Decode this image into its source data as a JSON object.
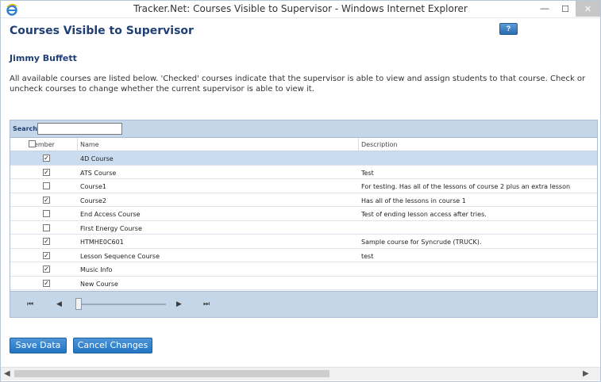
{
  "window": {
    "title": "Tracker.Net: Courses Visible to Supervisor - Windows Internet Explorer",
    "controls": {
      "minimize": "—",
      "maximize": "☐",
      "close": "✕"
    }
  },
  "page": {
    "title": "Courses Visible to Supervisor",
    "help_label": "?",
    "supervisor_name": "Jimmy Buffett",
    "intro": "All available courses are listed below. 'Checked' courses indicate that the supervisor is able to view and assign students to that course. Check or uncheck courses to change whether the current supervisor is able to view it."
  },
  "grid": {
    "search_label": "Search:",
    "search_value": "",
    "columns": {
      "member": "Member",
      "name": "Name",
      "description": "Description"
    },
    "header_checked": false,
    "rows": [
      {
        "checked": true,
        "name": "4D Course",
        "description": "",
        "selected": true
      },
      {
        "checked": true,
        "name": "ATS Course",
        "description": "Test",
        "selected": false
      },
      {
        "checked": false,
        "name": "Course1",
        "description": "For testing. Has all of the lessons of course 2 plus an extra lesson",
        "selected": false
      },
      {
        "checked": true,
        "name": "Course2",
        "description": "Has all of the lessons in course 1",
        "selected": false
      },
      {
        "checked": false,
        "name": "End Access Course",
        "description": "Test of ending lesson access after tries.",
        "selected": false
      },
      {
        "checked": false,
        "name": "First Energy Course",
        "description": "",
        "selected": false
      },
      {
        "checked": true,
        "name": "HTMHE0C601",
        "description": "Sample course for Syncrude (TRUCK).",
        "selected": false
      },
      {
        "checked": true,
        "name": "Lesson Sequence Course",
        "description": "test",
        "selected": false
      },
      {
        "checked": true,
        "name": "Music Info",
        "description": "",
        "selected": false
      },
      {
        "checked": true,
        "name": "New Course",
        "description": "",
        "selected": false
      }
    ],
    "pager": {
      "first": "⏮",
      "prev": "◀",
      "next": "▶",
      "last": "⏭",
      "slider_position": 0
    }
  },
  "actions": {
    "save_label": "Save Data",
    "cancel_label": "Cancel Changes"
  },
  "scrollbar": {
    "left": "◀",
    "right": "▶"
  }
}
